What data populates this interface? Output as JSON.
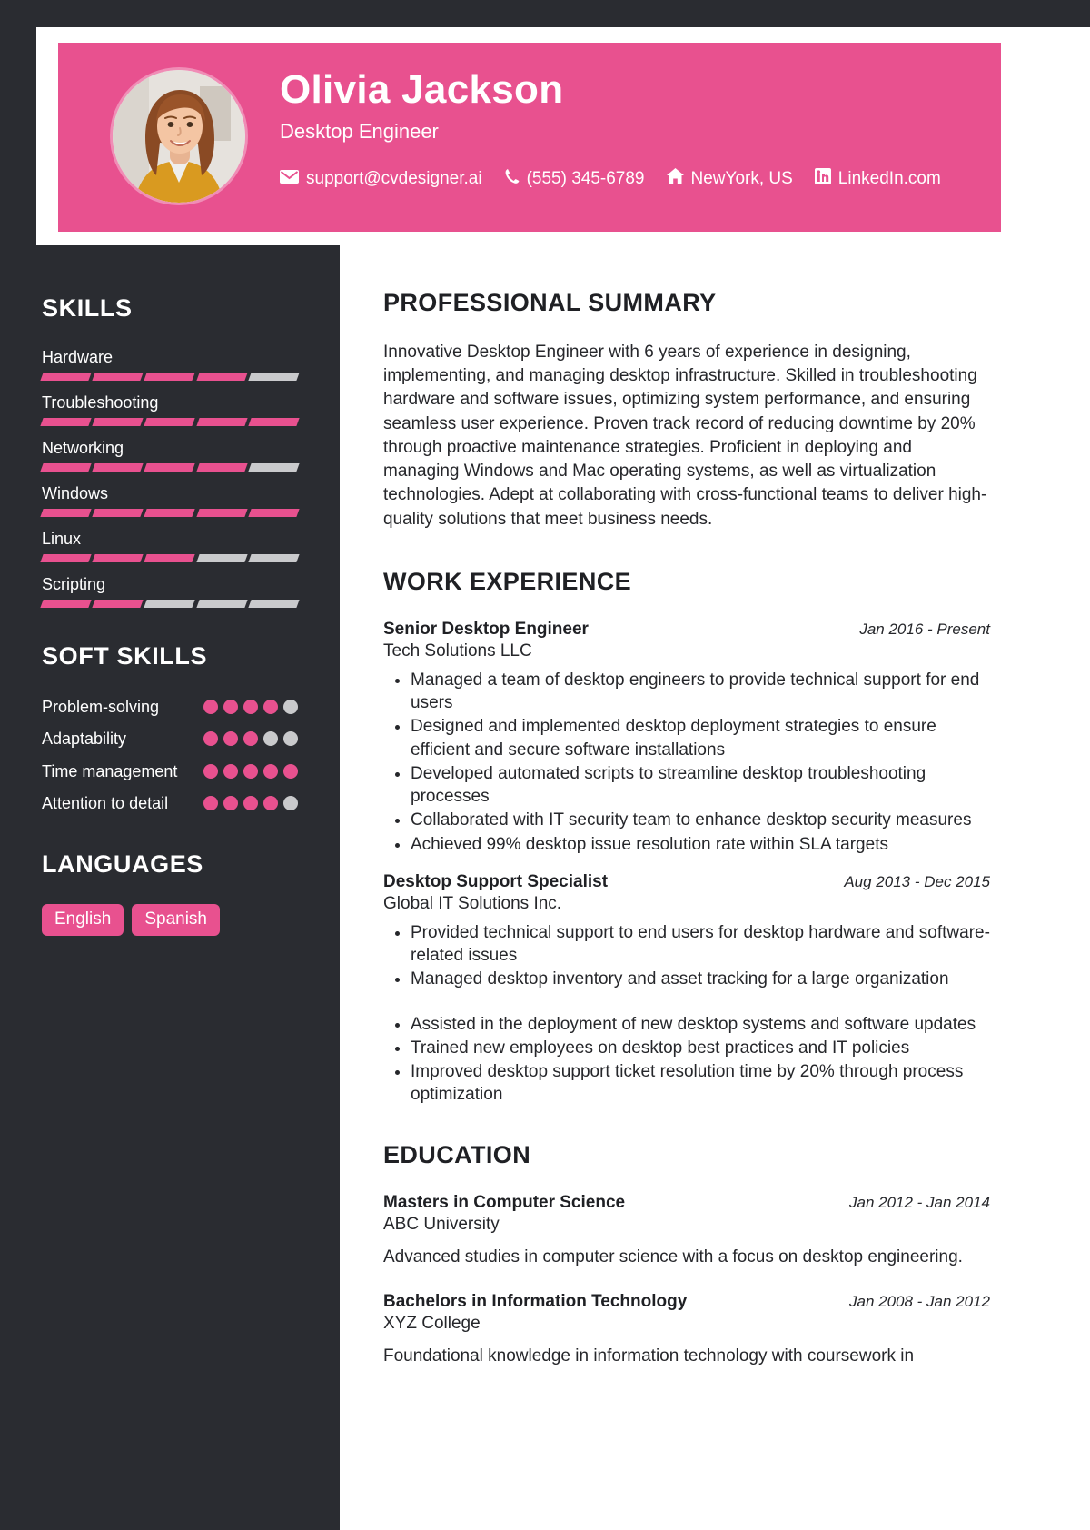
{
  "header": {
    "name": "Olivia Jackson",
    "job_title": "Desktop Engineer",
    "accent_color": "#e8518f",
    "contacts": [
      {
        "icon": "envelope-icon",
        "text": "support@cvdesigner.ai"
      },
      {
        "icon": "phone-icon",
        "text": "(555) 345-6789"
      },
      {
        "icon": "home-icon",
        "text": "NewYork, US"
      },
      {
        "icon": "linkedin-icon",
        "text": "LinkedIn.com"
      }
    ]
  },
  "sidebar": {
    "skills_heading": "SKILLS",
    "skills": [
      {
        "name": "Hardware",
        "level": 4,
        "max": 5
      },
      {
        "name": "Troubleshooting",
        "level": 5,
        "max": 5
      },
      {
        "name": "Networking",
        "level": 4,
        "max": 5
      },
      {
        "name": "Windows",
        "level": 5,
        "max": 5
      },
      {
        "name": "Linux",
        "level": 3,
        "max": 5
      },
      {
        "name": "Scripting",
        "level": 2,
        "max": 5
      }
    ],
    "soft_skills_heading": "SOFT SKILLS",
    "soft_skills": [
      {
        "name": "Problem-solving",
        "level": 4,
        "max": 5
      },
      {
        "name": "Adaptability",
        "level": 3,
        "max": 5
      },
      {
        "name": "Time management",
        "level": 5,
        "max": 5
      },
      {
        "name": "Attention to detail",
        "level": 4,
        "max": 5
      }
    ],
    "languages_heading": "LANGUAGES",
    "languages": [
      "English",
      "Spanish"
    ]
  },
  "main": {
    "summary_heading": "PROFESSIONAL SUMMARY",
    "summary_text": "Innovative Desktop Engineer with 6 years of experience in designing, implementing, and managing desktop infrastructure. Skilled in troubleshooting hardware and software issues, optimizing system performance, and ensuring seamless user experience. Proven track record of reducing downtime by 20% through proactive maintenance strategies. Proficient in deploying and managing Windows and Mac operating systems, as well as virtualization technologies. Adept at collaborating with cross-functional teams to deliver high-quality solutions that meet business needs.",
    "work_heading": "WORK EXPERIENCE",
    "work": [
      {
        "title": "Senior Desktop Engineer",
        "date": "Jan 2016 - Present",
        "org": "Tech Solutions LLC",
        "bullets": [
          "Managed a team of desktop engineers to provide technical support for end users",
          "Designed and implemented desktop deployment strategies to ensure efficient and secure software installations",
          "Developed automated scripts to streamline desktop troubleshooting processes",
          "Collaborated with IT security team to enhance desktop security measures",
          "Achieved 99% desktop issue resolution rate within SLA targets"
        ]
      },
      {
        "title": "Desktop Support Specialist",
        "date": "Aug 2013 - Dec 2015",
        "org": "Global IT Solutions Inc.",
        "bullets": [
          "Provided technical support to end users for desktop hardware and software-related issues",
          "Managed desktop inventory and asset tracking for a large organization",
          "",
          "Assisted in the deployment of new desktop systems and software updates",
          "Trained new employees on desktop best practices and IT policies",
          "Improved desktop support ticket resolution time by 20% through process optimization"
        ]
      }
    ],
    "education_heading": "EDUCATION",
    "education": [
      {
        "degree": "Masters in Computer Science",
        "date": "Jan 2012 - Jan 2014",
        "school": "ABC University",
        "description": "Advanced studies in computer science with a focus on desktop engineering."
      },
      {
        "degree": "Bachelors in Information Technology",
        "date": "Jan 2008 - Jan 2012",
        "school": "XYZ College",
        "description": "Foundational knowledge in information technology with coursework in"
      }
    ]
  }
}
